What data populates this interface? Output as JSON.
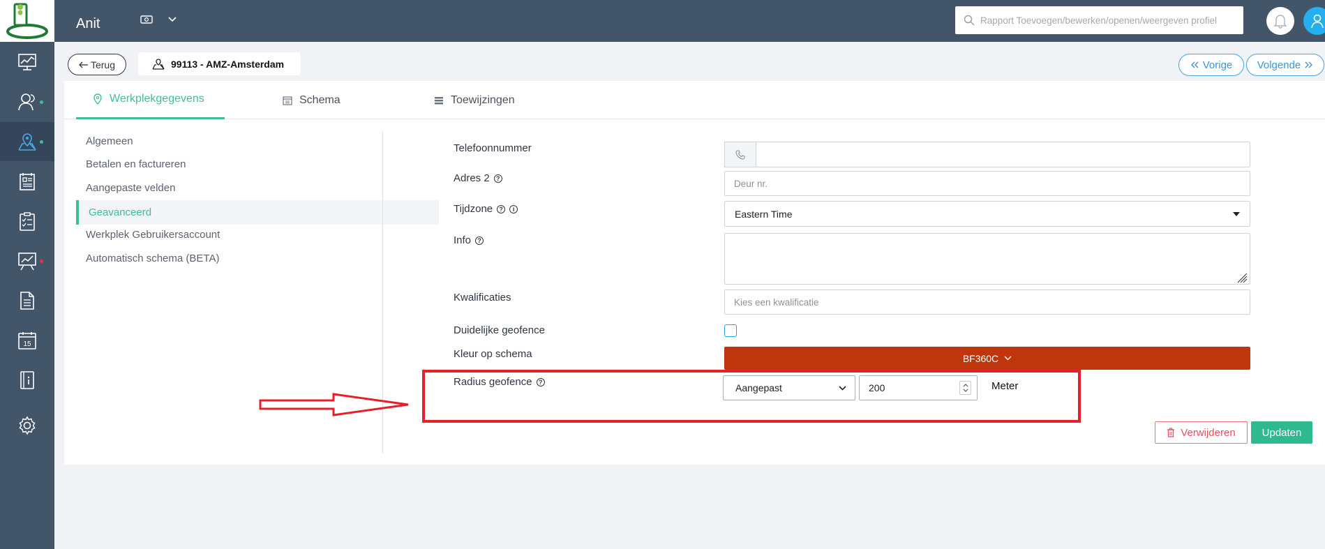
{
  "app": {
    "name": "Anit"
  },
  "sidebar": {
    "icons": [
      "dashboard-icon",
      "users-icon",
      "map-pin-icon",
      "report-icon",
      "clipboard-icon",
      "analytics-icon",
      "document-icon",
      "calendar-icon",
      "book-icon",
      "settings-icon"
    ],
    "calendar_day": "15"
  },
  "header": {
    "search_placeholder": "Rapport Toevoegen/bewerken/openen/weergeven profiel"
  },
  "subheader": {
    "back_label": "Terug",
    "record_title": "99113 - AMZ-Amsterdam",
    "prev_label": "Vorige",
    "next_label": "Volgende"
  },
  "tabs": [
    {
      "label": "Werkplekgegevens",
      "active": true
    },
    {
      "label": "Schema",
      "active": false
    },
    {
      "label": "Toewijzingen",
      "active": false
    }
  ],
  "side_menu": [
    {
      "label": "Algemeen"
    },
    {
      "label": "Betalen en factureren"
    },
    {
      "label": "Aangepaste velden"
    },
    {
      "label": "Geavanceerd",
      "active": true
    },
    {
      "label": "Werkplek Gebruikersaccount"
    },
    {
      "label": "Automatisch schema (BETA)"
    }
  ],
  "form": {
    "phone": {
      "label": "Telefoonnummer",
      "value": ""
    },
    "address2": {
      "label": "Adres 2",
      "placeholder": "Deur nr.",
      "value": ""
    },
    "timezone": {
      "label": "Tijdzone",
      "value": "Eastern Time"
    },
    "info": {
      "label": "Info",
      "value": ""
    },
    "qualifications": {
      "label": "Kwalificaties",
      "placeholder": "Kies een kwalificatie"
    },
    "clear_geofence": {
      "label": "Duidelijke geofence",
      "checked": false
    },
    "schedule_color": {
      "label": "Kleur op schema",
      "value": "BF360C"
    },
    "radius": {
      "label": "Radius geofence",
      "mode": "Aangepast",
      "value": "200",
      "unit": "Meter"
    }
  },
  "actions": {
    "delete_label": "Verwijderen",
    "update_label": "Updaten"
  },
  "colors": {
    "accent": "#3fbd9a",
    "nav_bg": "#435569",
    "schedule_color": "#bf360c",
    "highlight": "#e5202a"
  }
}
